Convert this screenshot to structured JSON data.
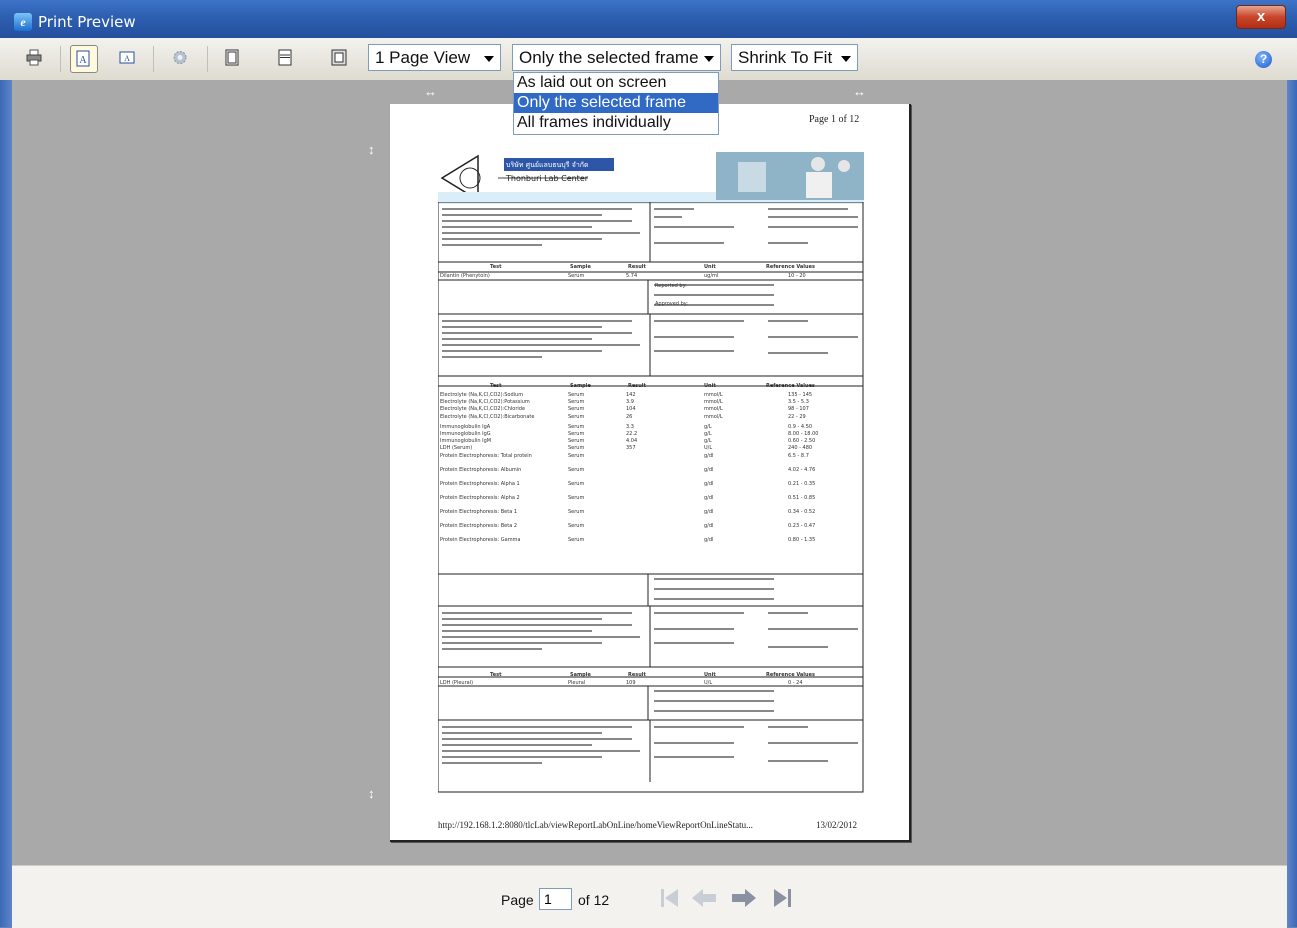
{
  "window": {
    "title": "Print Preview",
    "close_label": "x"
  },
  "toolbar": {
    "page_view": "1 Page View",
    "frame_mode": "Only the selected frame",
    "fit_mode": "Shrink To Fit",
    "help_label": "?"
  },
  "frame_dropdown": {
    "options": [
      "As laid out on screen",
      "Only the selected frame",
      "All frames individually"
    ],
    "selected": "Only the selected frame"
  },
  "document": {
    "page_header": "Page 1 of 12",
    "lab_name_thai": "บริษัท ศูนย์แลบธนบุรี จำกัด",
    "lab_name_en": "Thonburi Lab Center",
    "footer_url": "http://192.168.1.2:8080/tlcLab/viewReportLabOnLine/homeViewReportOnLineStatu...",
    "footer_date": "13/02/2012",
    "sections": [
      {
        "columns": [
          "Test",
          "Sample",
          "Result",
          "Unit",
          "Reference Values"
        ],
        "rows": [
          [
            "Dilantin (Phenytoin)",
            "Serum",
            "5.74",
            "ug/ml",
            "10 - 20"
          ]
        ],
        "reported_by": "Reported by:",
        "approved_by": "Approved by:"
      },
      {
        "columns": [
          "Test",
          "Sample",
          "Result",
          "Unit",
          "Reference Values"
        ],
        "rows": [
          [
            "Electrolyte (Na,K,Cl,CO2):Sodium",
            "Serum",
            "142",
            "mmol/L",
            "135 - 145"
          ],
          [
            "Electrolyte (Na,K,Cl,CO2):Potassium",
            "Serum",
            "3.9",
            "mmol/L",
            "3.5 - 5.3"
          ],
          [
            "Electrolyte (Na,K,Cl,CO2):Chloride",
            "Serum",
            "104",
            "mmol/L",
            "98 - 107"
          ],
          [
            "Electrolyte (Na,K,Cl,CO2):Bicarbonate",
            "Serum",
            "26",
            "mmol/L",
            "22 - 29"
          ],
          [
            "Immunoglobulin IgA",
            "Serum",
            "3.3",
            "g/L",
            "0.9 - 4.50"
          ],
          [
            "Immunoglobulin IgG",
            "Serum",
            "22.2",
            "g/L",
            "8.00 - 18.00"
          ],
          [
            "Immunoglobulin IgM",
            "Serum",
            "4.04",
            "g/L",
            "0.60 - 2.50"
          ],
          [
            "LDH (Serum)",
            "Serum",
            "357",
            "U/L",
            "240 - 480"
          ],
          [
            "Protein Electrophoresis: Total protein",
            "Serum",
            "",
            "g/dl",
            "6.5 - 8.7"
          ],
          [
            "Protein Electrophoresis: Albumin",
            "Serum",
            "",
            "g/dl",
            "4.02 - 4.76"
          ],
          [
            "Protein Electrophoresis: Alpha 1",
            "Serum",
            "",
            "g/dl",
            "0.21 - 0.35"
          ],
          [
            "Protein Electrophoresis: Alpha 2",
            "Serum",
            "",
            "g/dl",
            "0.51 - 0.85"
          ],
          [
            "Protein Electrophoresis: Beta 1",
            "Serum",
            "",
            "g/dl",
            "0.34 - 0.52"
          ],
          [
            "Protein Electrophoresis: Beta 2",
            "Serum",
            "",
            "g/dl",
            "0.23 - 0.47"
          ],
          [
            "Protein Electrophoresis: Gamma",
            "Serum",
            "",
            "g/dl",
            "0.80 - 1.35"
          ]
        ]
      },
      {
        "columns": [
          "Test",
          "Sample",
          "Result",
          "Unit",
          "Reference Values"
        ],
        "rows": [
          [
            "LDH (Pleural)",
            "Pleural",
            "109",
            "U/L",
            "0 - 24"
          ]
        ]
      }
    ]
  },
  "footer": {
    "page_label": "Page",
    "page_value": "1",
    "of_label": "of 12"
  }
}
